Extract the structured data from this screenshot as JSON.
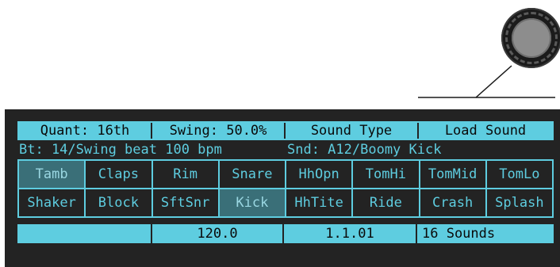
{
  "knob": {
    "icon": "rotary-knob-icon"
  },
  "top_bar": {
    "quant": "Quant: 16th",
    "swing": "Swing: 50.0%",
    "sound_type": "Sound Type",
    "load_sound": "Load Sound"
  },
  "status": {
    "beat_info": "Bt: 14/Swing beat 100 bpm",
    "sound_info": "Snd: A12/Boomy Kick"
  },
  "pads": {
    "row1": [
      "Tamb",
      "Claps",
      "Rim",
      "Snare",
      "HhOpn",
      "TomHi",
      "TomMid",
      "TomLo"
    ],
    "row2": [
      "Shaker",
      "Block",
      "SftSnr",
      "Kick",
      "HhTite",
      "Ride",
      "Crash",
      "Splash"
    ]
  },
  "bottom_bar": {
    "empty": "",
    "tempo": "120.0",
    "position": "1.1.01",
    "sound_count": "16 Sounds"
  },
  "colors": {
    "accent": "#5ecde0",
    "panel": "#232323",
    "selected": "#3a6f78"
  }
}
